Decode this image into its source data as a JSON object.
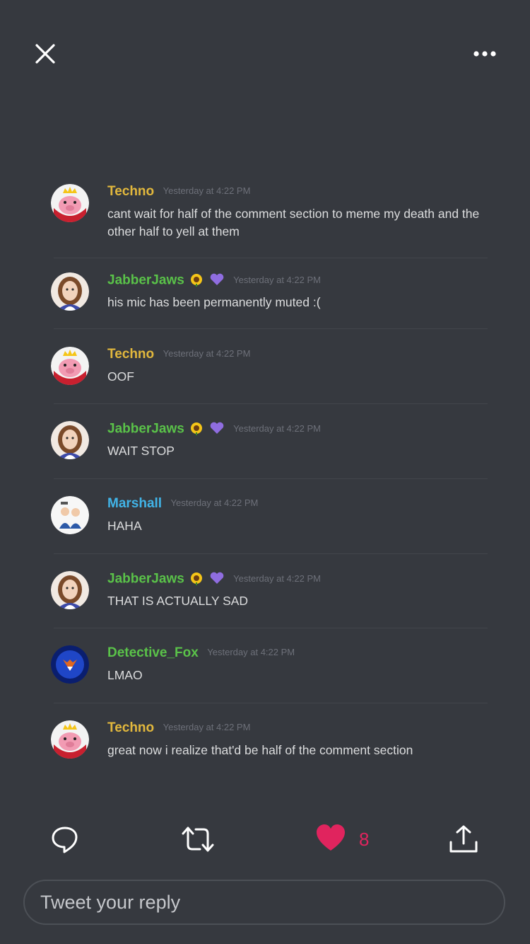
{
  "colors": {
    "background": "#36393f",
    "techno": "#e2b83d",
    "jabberjaws": "#5ac249",
    "marshall": "#41b4e8",
    "detective_fox": "#5ac249",
    "like": "#e0245e"
  },
  "icons": {
    "close": "close-icon",
    "more": "more-horizontal-icon",
    "reply": "reply-bubble-icon",
    "retweet": "retweet-icon",
    "like": "heart-icon",
    "share": "share-icon"
  },
  "messages": [
    {
      "author": "Techno",
      "time": "Yesterday at 4:22 PM",
      "text": "cant wait for half of the comment section to meme my death and the other half to yell at them"
    },
    {
      "author": "JabberJaws",
      "time": "Yesterday at 4:22 PM",
      "text": "his mic has been permanently muted :("
    },
    {
      "author": "Techno",
      "time": "Yesterday at 4:22 PM",
      "text": "OOF"
    },
    {
      "author": "JabberJaws",
      "time": "Yesterday at 4:22 PM",
      "text": "WAIT STOP"
    },
    {
      "author": "Marshall",
      "time": "Yesterday at 4:22 PM",
      "text": "HAHA"
    },
    {
      "author": "JabberJaws",
      "time": "Yesterday at 4:22 PM",
      "text": "THAT IS ACTUALLY SAD"
    },
    {
      "author": "Detective_Fox",
      "time": "Yesterday at 4:22 PM",
      "text": "LMAO"
    },
    {
      "author": "Techno",
      "time": "Yesterday at 4:22 PM",
      "text": "great now i realize that'd be half of the comment section"
    }
  ],
  "actions": {
    "like_count": "8"
  },
  "reply": {
    "placeholder": "Tweet your reply"
  }
}
